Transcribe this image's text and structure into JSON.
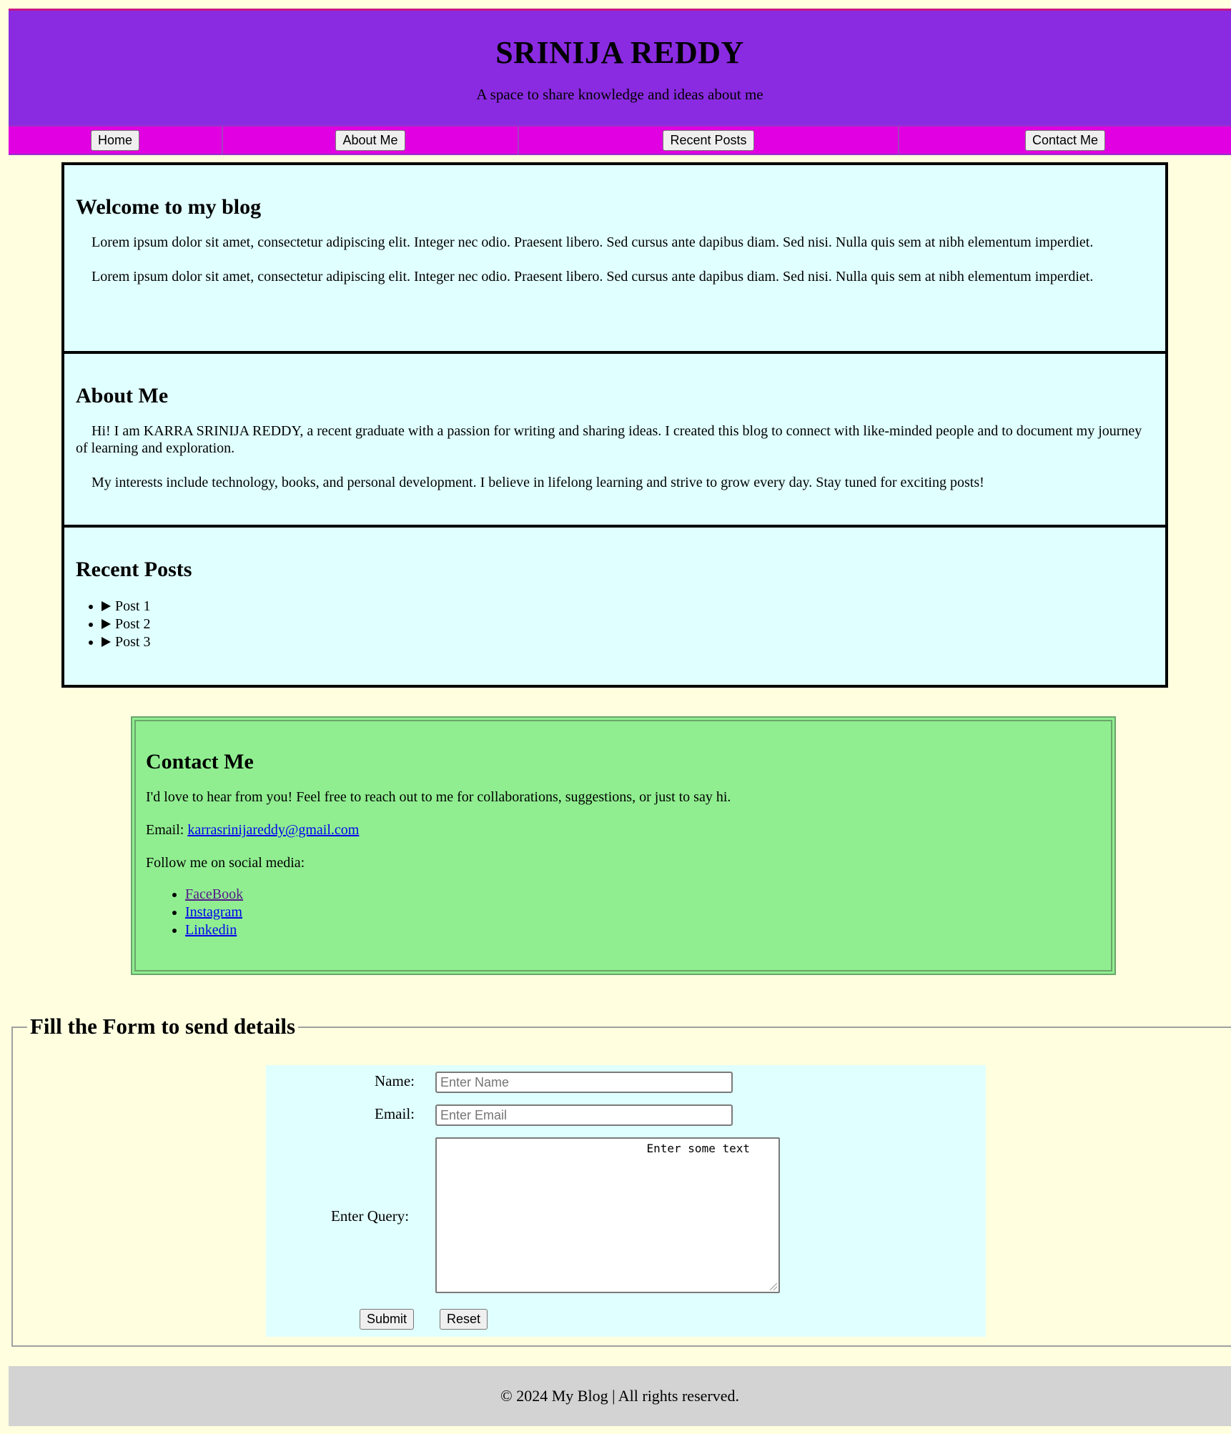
{
  "header": {
    "title": "SRINIJA REDDY",
    "tagline": "A space to share knowledge and ideas about me"
  },
  "nav": {
    "items": [
      {
        "label": "Home"
      },
      {
        "label": "About Me"
      },
      {
        "label": "Recent Posts"
      },
      {
        "label": "Contact Me"
      }
    ]
  },
  "blog": {
    "welcome": {
      "heading": "Welcome to my blog",
      "paragraphs": [
        "Lorem ipsum dolor sit amet, consectetur adipiscing elit. Integer nec odio. Praesent libero. Sed cursus ante dapibus diam. Sed nisi. Nulla quis sem at nibh elementum imperdiet.",
        "Lorem ipsum dolor sit amet, consectetur adipiscing elit. Integer nec odio. Praesent libero. Sed cursus ante dapibus diam. Sed nisi. Nulla quis sem at nibh elementum imperdiet."
      ]
    },
    "about": {
      "heading": "About Me",
      "paragraphs": [
        "Hi! I am KARRA SRINIJA REDDY, a recent graduate with a passion for writing and sharing ideas. I created this blog to connect with like-minded people and to document my journey of learning and exploration.",
        "My interests include technology, books, and personal development. I believe in lifelong learning and strive to grow every day. Stay tuned for exciting posts!"
      ]
    },
    "posts": {
      "heading": "Recent Posts",
      "items": [
        "Post 1",
        "Post 2",
        "Post 3"
      ]
    }
  },
  "contact": {
    "heading": "Contact Me",
    "intro": "I'd love to hear from you! Feel free to reach out to me for collaborations, suggestions, or just to say hi.",
    "email_label": "Email: ",
    "email": "karrasrinijareddy@gmail.com",
    "follow": "Follow me on social media:",
    "social": [
      "FaceBook",
      "Instagram",
      "Linkedin"
    ]
  },
  "form": {
    "legend": "Fill the Form to send details",
    "name_label": "Name:",
    "name_placeholder": "Enter Name",
    "email_label": "Email:",
    "email_placeholder": "Enter Email",
    "query_label": "Enter Query:",
    "query_text": "Enter some text",
    "submit": "Submit",
    "reset": "Reset"
  },
  "footer": {
    "text": "© 2024 My Blog | All rights reserved."
  },
  "colors": {
    "page_bg": "#ffffe0",
    "header_bg": "#8a2be2",
    "nav_bg": "#e100e1",
    "blog_bg": "#e0ffff",
    "contact_bg": "#90ee90",
    "footer_bg": "#d3d3d3"
  }
}
